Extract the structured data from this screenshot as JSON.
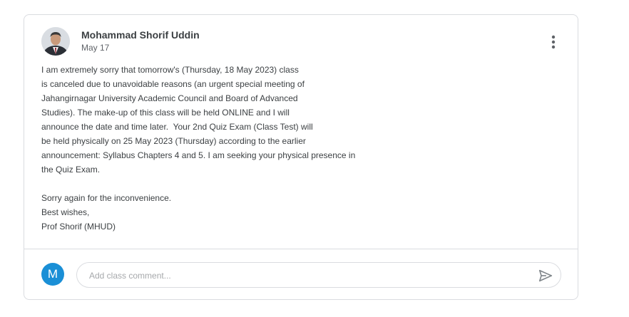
{
  "post": {
    "author": "Mohammad Shorif Uddin",
    "date": "May 17",
    "body_lines": [
      "I am extremely sorry that tomorrow's (Thursday, 18 May 2023) class",
      "is canceled due to unavoidable reasons (an urgent special meeting of",
      "Jahangirnagar University Academic Council and Board of Advanced",
      "Studies). The make-up of this class will be held ONLINE and I will",
      "announce the date and time later.  Your 2nd Quiz Exam (Class Test) will",
      "be held physically on 25 May 2023 (Thursday) according to the earlier",
      "announcement: Syllabus Chapters 4 and 5. I am seeking your physical presence in",
      "the Quiz Exam.",
      "",
      "Sorry again for the inconvenience.",
      "Best wishes,",
      "Prof Shorif (MHUD)"
    ]
  },
  "comment": {
    "user_initial": "M",
    "placeholder": "Add class comment...",
    "value": ""
  },
  "colors": {
    "user_avatar": "#1a8fd6",
    "border": "#dadce0",
    "text": "#3c4043",
    "muted": "#5f6368"
  },
  "icons": {
    "menu": "more-vert-icon",
    "send": "send-icon"
  }
}
